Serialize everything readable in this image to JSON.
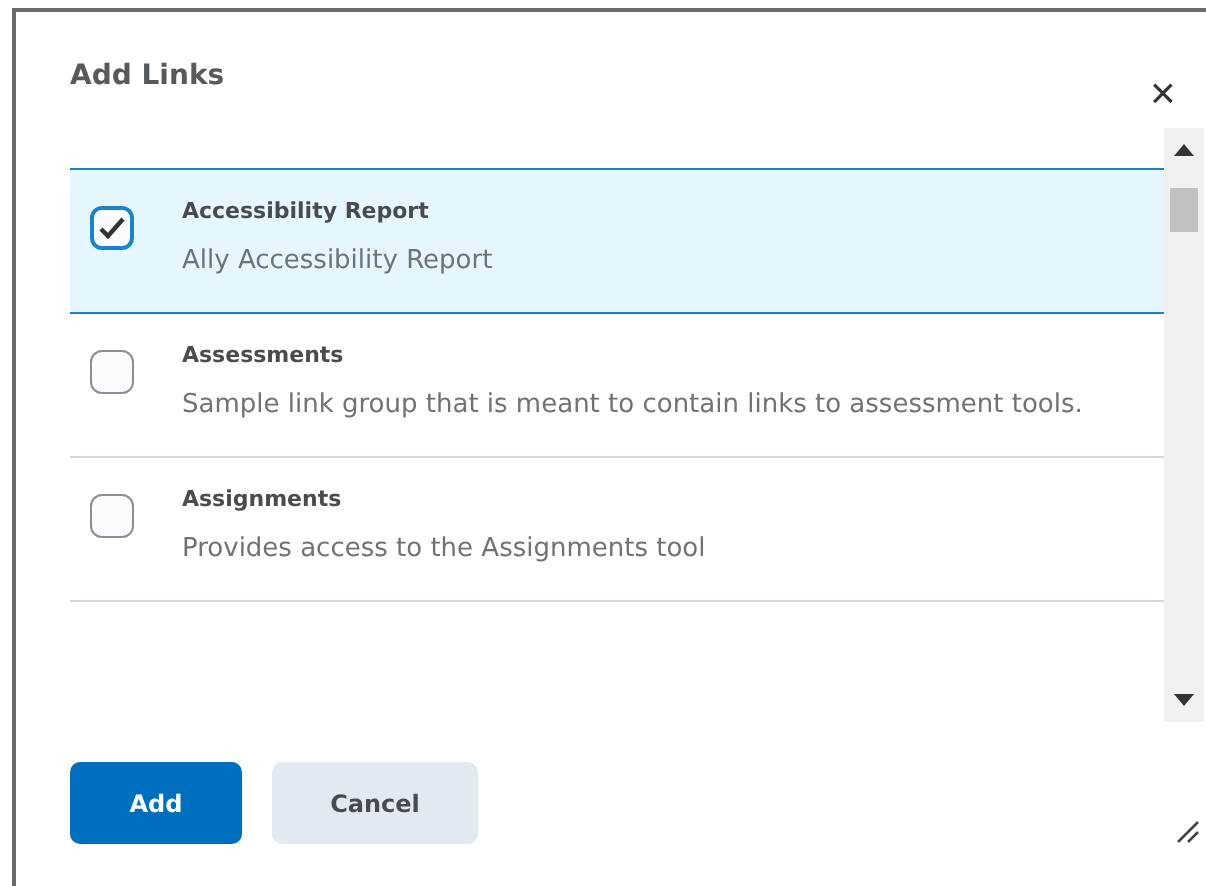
{
  "dialog": {
    "title": "Add Links",
    "close": "×"
  },
  "links": [
    {
      "name": "Accessibility Report",
      "description": "Ally Accessibility Report",
      "checked": true,
      "selected": true
    },
    {
      "name": "Assessments",
      "description": "Sample link group that is meant to contain links to assessment tools.",
      "checked": false,
      "selected": false
    },
    {
      "name": "Assignments",
      "description": "Provides access to the Assignments tool",
      "checked": false,
      "selected": false
    }
  ],
  "buttons": [
    {
      "label": "Add",
      "kind": "primary"
    },
    {
      "label": "Cancel",
      "kind": "secondary"
    }
  ]
}
